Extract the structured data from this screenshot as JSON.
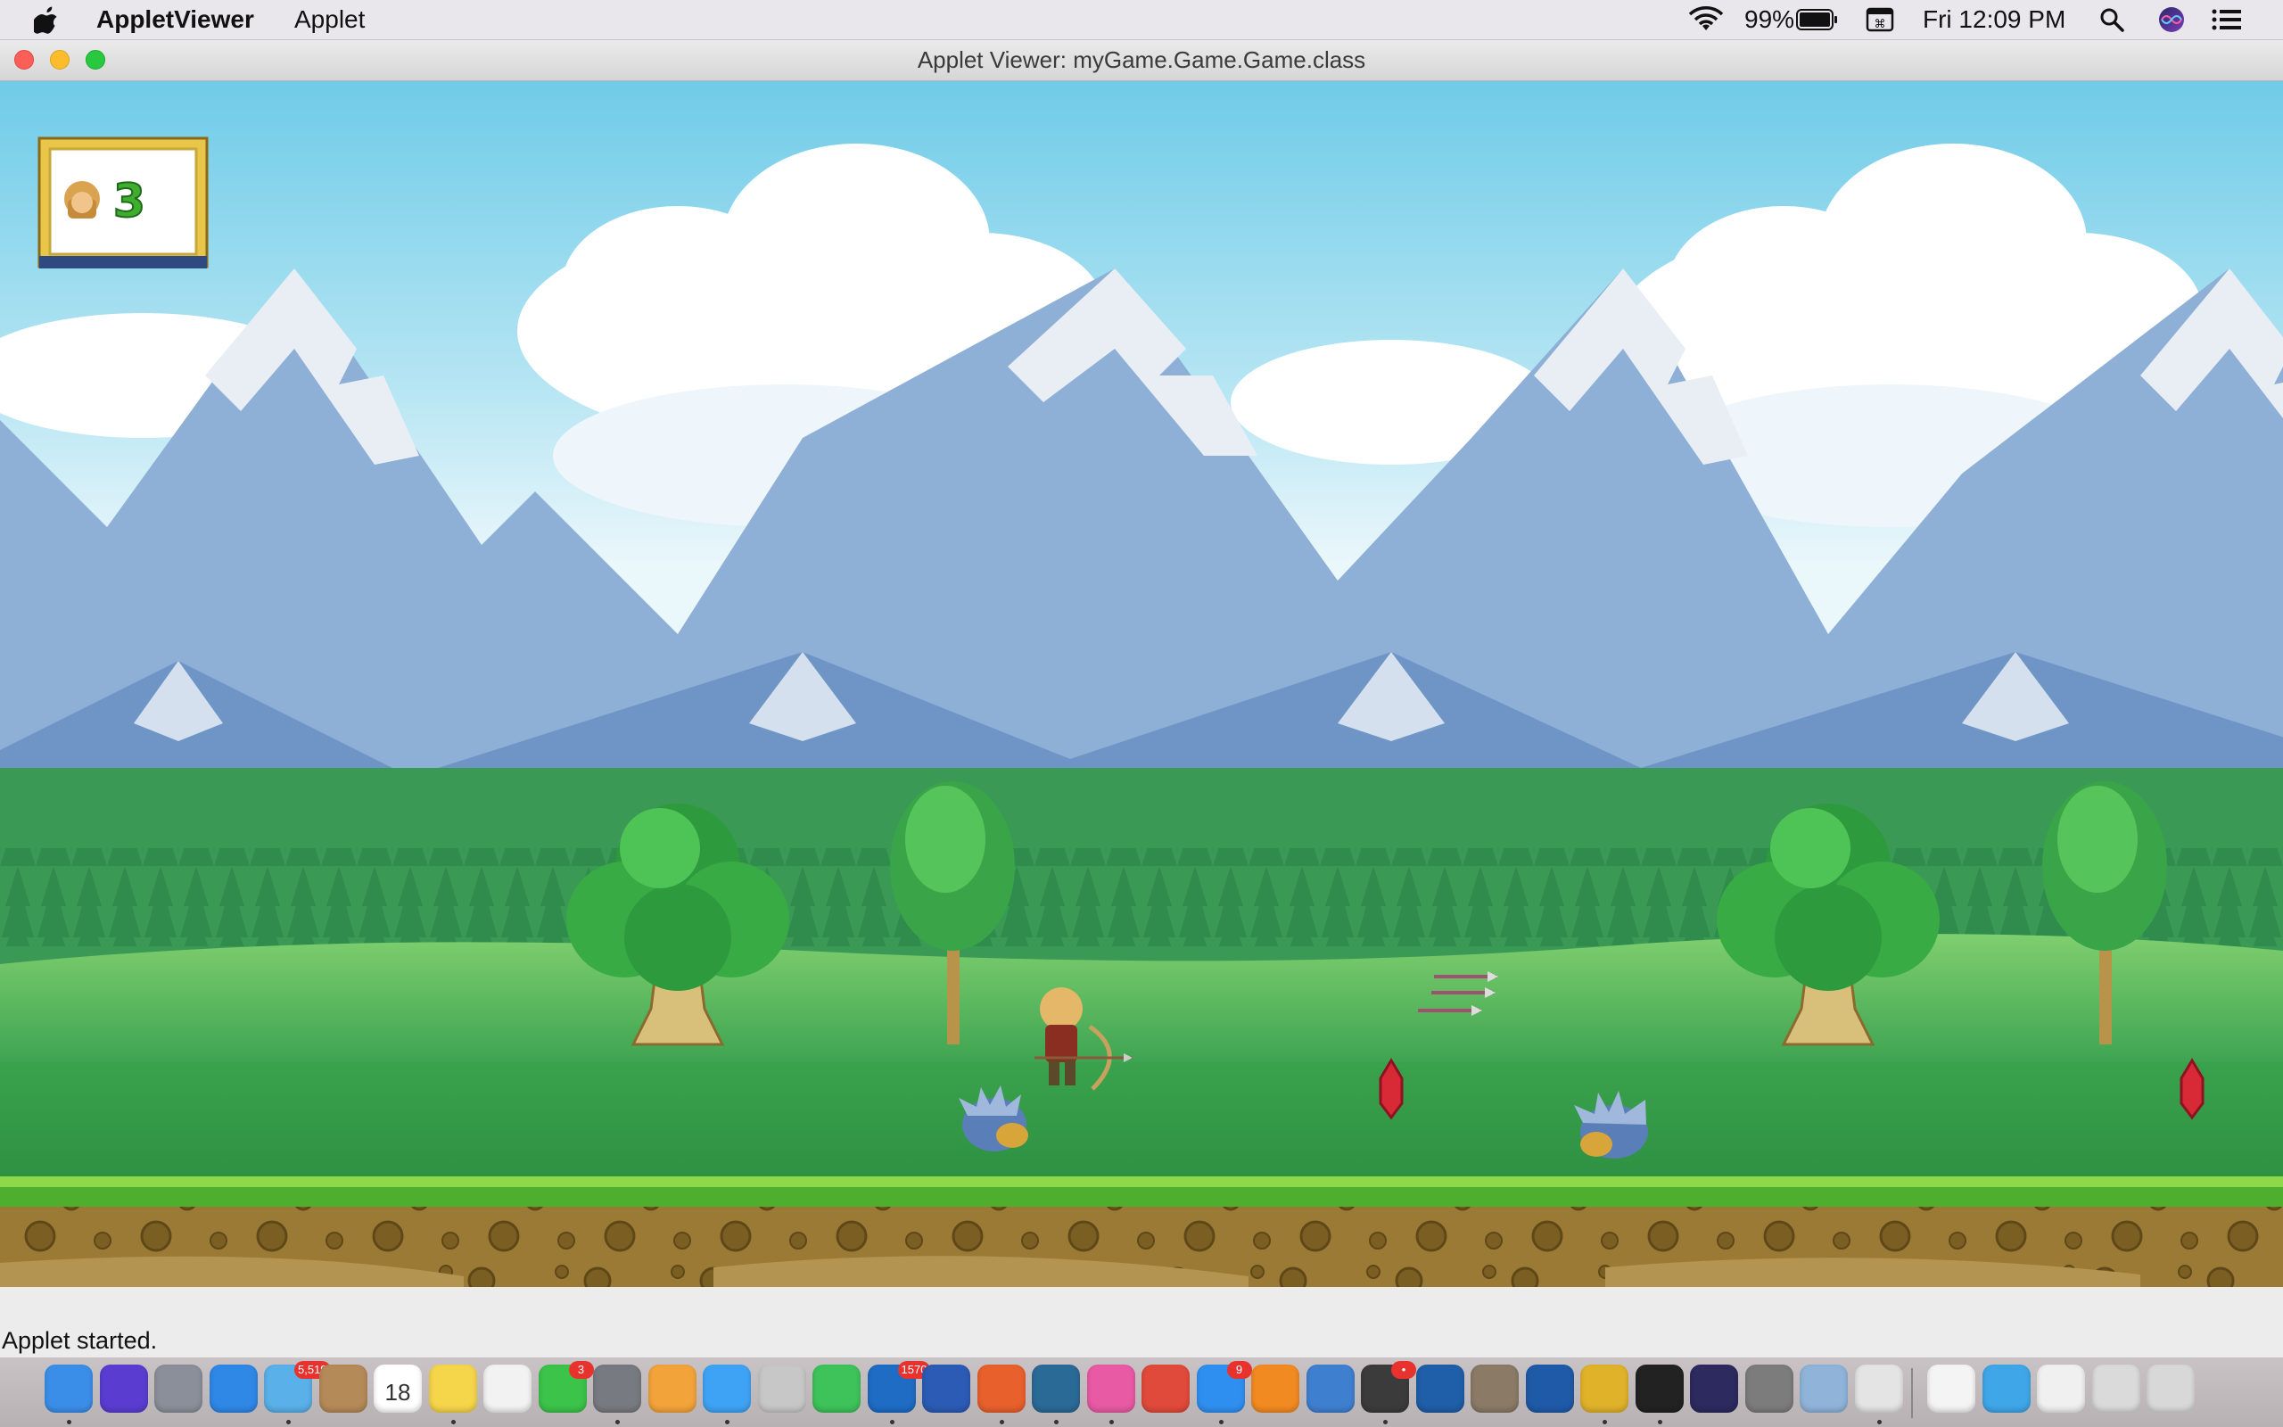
{
  "menubar": {
    "app_name": "AppletViewer",
    "menu_applet": "Applet",
    "battery": "99%",
    "clock": "Fri 12:09 PM"
  },
  "window": {
    "title": "Applet Viewer: myGame.Game.Game.class",
    "status": "Applet started."
  },
  "game": {
    "lives": "3",
    "colors": {
      "sky": "#73cde8",
      "mountain": "#8fb0d6",
      "snow": "#e9eef5",
      "forest": "#2f8f4a",
      "grass": "#57b85a",
      "dirt": "#9b7a35"
    }
  },
  "dock": {
    "items": [
      {
        "name": "finder-icon",
        "color": "#3b8ee8"
      },
      {
        "name": "siri-icon",
        "color": "#5a3dd0"
      },
      {
        "name": "launchpad-icon",
        "color": "#8a8f99"
      },
      {
        "name": "safari-icon",
        "color": "#2f87e6"
      },
      {
        "name": "mail-icon",
        "color": "#5ab0e8",
        "badge": "5,519"
      },
      {
        "name": "contacts-icon",
        "color": "#b48a58"
      },
      {
        "name": "calendar-icon",
        "color": "#ffffff",
        "label": "18"
      },
      {
        "name": "notes-icon",
        "color": "#f5d54a"
      },
      {
        "name": "reminders-icon",
        "color": "#f2f2f2"
      },
      {
        "name": "facetime-icon",
        "color": "#3cc34a",
        "badge": "3"
      },
      {
        "name": "system-preferences-icon",
        "color": "#777a80"
      },
      {
        "name": "photos-icon",
        "color": "#f2a33a"
      },
      {
        "name": "messages-icon",
        "color": "#3fa3f5"
      },
      {
        "name": "help-icon",
        "color": "#c7c7c7"
      },
      {
        "name": "whatsapp-icon",
        "color": "#3ec25a"
      },
      {
        "name": "outlook-icon",
        "color": "#1e6cc4",
        "badge": "1570"
      },
      {
        "name": "word-icon",
        "color": "#2b5bb5"
      },
      {
        "name": "firefox-icon",
        "color": "#e8602c"
      },
      {
        "name": "mysql-workbench-icon",
        "color": "#2a6a96"
      },
      {
        "name": "itunes-icon",
        "color": "#e85aa4"
      },
      {
        "name": "photo-booth-icon",
        "color": "#e04a3a"
      },
      {
        "name": "app-store-icon",
        "color": "#2f8ff0",
        "badge": "9"
      },
      {
        "name": "ibooks-icon",
        "color": "#f28a22"
      },
      {
        "name": "xcode-icon",
        "color": "#3f7fd0"
      },
      {
        "name": "sublime-icon",
        "color": "#3b3b3b",
        "badge": "•"
      },
      {
        "name": "virtualbox-icon",
        "color": "#1f5ea8"
      },
      {
        "name": "gimp-icon",
        "color": "#8a7a66"
      },
      {
        "name": "sourcetree-icon",
        "color": "#1f5aa8"
      },
      {
        "name": "chrome-icon",
        "color": "#e0b22a"
      },
      {
        "name": "terminal-icon",
        "color": "#222222"
      },
      {
        "name": "eclipse-icon",
        "color": "#2c2a5e"
      },
      {
        "name": "netbeans-icon",
        "color": "#7c7c7c"
      },
      {
        "name": "preview-icon",
        "color": "#8fb3d9"
      },
      {
        "name": "java-icon",
        "color": "#e4e4e4"
      },
      {
        "name": "document-icon",
        "color": "#f4f4f4"
      },
      {
        "name": "folder-icon",
        "color": "#3fa6e8"
      },
      {
        "name": "downloads-stack-icon",
        "color": "#f0f0f0"
      },
      {
        "name": "screenshot-stack-icon",
        "color": "#dadada"
      },
      {
        "name": "trash-icon",
        "color": "#d8d8d8"
      }
    ]
  }
}
